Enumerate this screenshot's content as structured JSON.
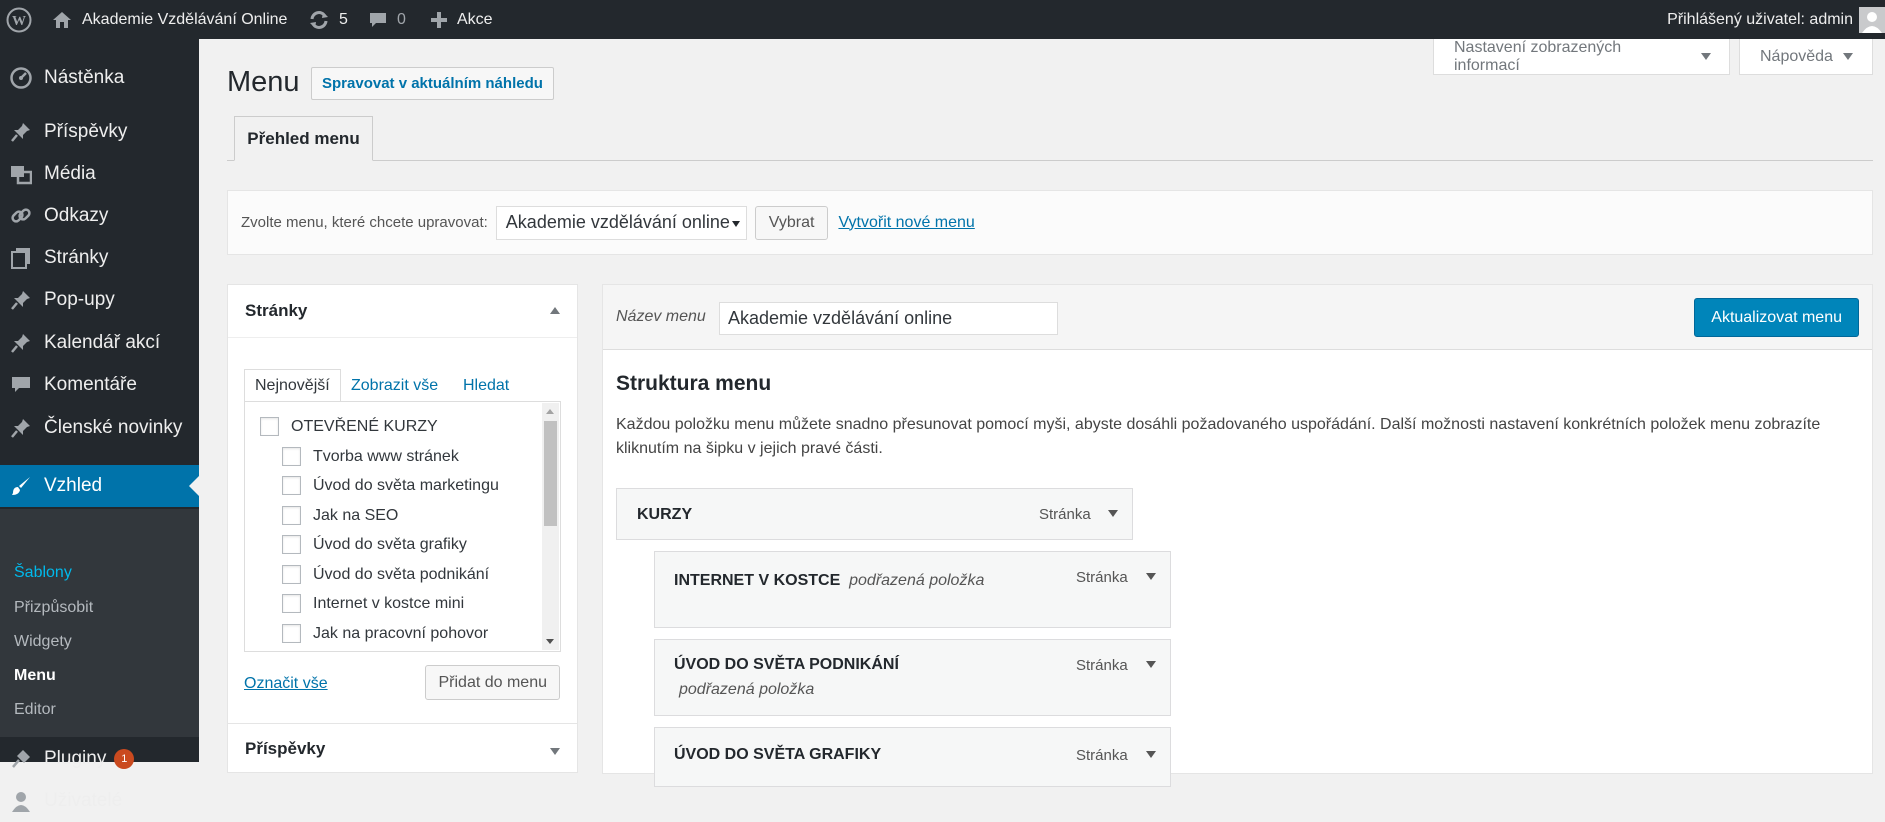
{
  "admin_bar": {
    "site_name": "Akademie Vzdělávání Online",
    "updates_count": "5",
    "comments_count": "0",
    "new_label": "Akce",
    "user_greeting": "Přihlášený uživatel: admin"
  },
  "sidebar": {
    "items": [
      {
        "label": "Nástěnka",
        "icon": "dashboard-icon"
      },
      {
        "label": "Příspěvky",
        "icon": "pin-icon"
      },
      {
        "label": "Média",
        "icon": "media-icon"
      },
      {
        "label": "Odkazy",
        "icon": "link-icon"
      },
      {
        "label": "Stránky",
        "icon": "pages-icon"
      },
      {
        "label": "Pop-upy",
        "icon": "pin-icon"
      },
      {
        "label": "Kalendář akcí",
        "icon": "pin-icon"
      },
      {
        "label": "Komentáře",
        "icon": "comment-icon"
      },
      {
        "label": "Členské novinky",
        "icon": "pin-icon"
      },
      {
        "label": "Vzhled",
        "icon": "brush-icon"
      },
      {
        "label": "Pluginy",
        "icon": "plugin-icon",
        "badge": "1"
      },
      {
        "label": "Uživatelé",
        "icon": "users-icon"
      }
    ],
    "submenu": [
      "Šablony",
      "Přizpůsobit",
      "Widgety",
      "Menu",
      "Editor"
    ]
  },
  "screen_options": {
    "options_label": "Nastavení zobrazených informací",
    "help_label": "Nápověda"
  },
  "page": {
    "title": "Menu",
    "preview_button": "Spravovat v aktuálním náhledu",
    "tab": "Přehled menu"
  },
  "manage": {
    "label": "Zvolte menu, které chcete upravovat:",
    "selected": "Akademie vzdělávání online",
    "choose_button": "Vybrat",
    "create_link": "Vytvořit nové menu"
  },
  "pages_box": {
    "title": "Stránky",
    "tabs": [
      "Nejnovější",
      "Zobrazit vše",
      "Hledat"
    ],
    "items": [
      {
        "label": "OTEVŘENÉ KURZY",
        "level": 0
      },
      {
        "label": "Tvorba www stránek",
        "level": 1
      },
      {
        "label": "Úvod do světa marketingu",
        "level": 1
      },
      {
        "label": "Jak na SEO",
        "level": 1
      },
      {
        "label": "Úvod do světa grafiky",
        "level": 1
      },
      {
        "label": "Úvod do světa podnikání",
        "level": 1
      },
      {
        "label": "Internet v kostce mini",
        "level": 1
      },
      {
        "label": "Jak na pracovní pohovor",
        "level": 1
      }
    ],
    "select_all": "Označit vše",
    "add_button": "Přidat do menu"
  },
  "posts_box": {
    "title": "Příspěvky"
  },
  "edit": {
    "name_label": "Název menu",
    "name_value": "Akademie vzdělávání online",
    "save_button": "Aktualizovat menu",
    "structure_title": "Struktura menu",
    "structure_desc": "Každou položku menu můžete snadno přesunovat pomocí myši, abyste dosáhli požadovaného uspořádání. Další možnosti nastavení konkrétních položek menu zobrazíte kliknutím na šipku v jejich pravé části.",
    "items": [
      {
        "title": "KURZY",
        "sub": "",
        "type": "Stránka"
      },
      {
        "title": "INTERNET V KOSTCE",
        "sub": "podřazená položka",
        "type": "Stránka"
      },
      {
        "title": "ÚVOD DO SVĚTA PODNIKÁNÍ",
        "sub": "podřazená položka",
        "type": "Stránka"
      },
      {
        "title": "ÚVOD DO SVĚTA GRAFIKY",
        "sub": "",
        "type": "Stránka"
      }
    ]
  },
  "colors": {
    "accent": "#0073aa",
    "button_primary": "#0085ba",
    "sidebar_bg": "#23282d",
    "badge": "#ca4a1f"
  }
}
